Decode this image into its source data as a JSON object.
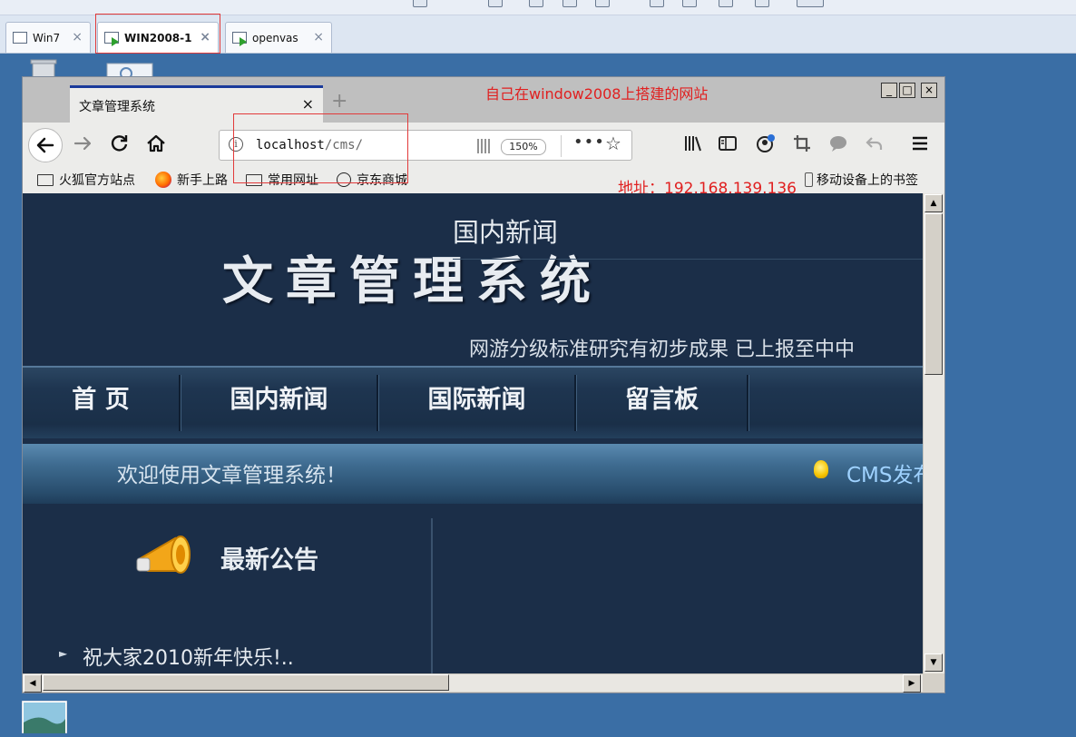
{
  "vm": {
    "tabs": [
      {
        "label": "Win7"
      },
      {
        "label": "WIN2008-1"
      },
      {
        "label": "openvas"
      }
    ],
    "close_glyph": "×"
  },
  "browser": {
    "tab_title": "文章管理系统",
    "tab_close": "×",
    "new_tab": "+",
    "annotation_title": "自己在window2008上搭建的网站",
    "window_controls": {
      "minimize": "_",
      "maximize": "□",
      "close": "×"
    },
    "url": {
      "host": "localhost",
      "path": "/cms/"
    },
    "zoom": "150%",
    "bookmarks": [
      "火狐官方站点",
      "新手上路",
      "常用网址",
      "京东商城"
    ],
    "annotation_address": "地址：192.168.139.136",
    "mobile_bookmarks": "移动设备上的书签",
    "toolbar_icons": [
      "library-icon",
      "sidebar-icon",
      "account-icon",
      "screenshot-icon",
      "chat-icon",
      "undo-icon",
      "menu-icon"
    ]
  },
  "site": {
    "title": "文章管理系统",
    "nav": [
      "首 页",
      "国内新闻",
      "国际新闻",
      "留言板"
    ],
    "welcome": "欢迎使用文章管理系统！",
    "ticker": "CMS发布",
    "notice_title": "最新公告",
    "notice_items": [
      "祝大家2010新年快乐!.."
    ],
    "news_title": "国内新闻",
    "news_items": [
      "网游分级标准研究有初步成果 已上报至中中"
    ]
  }
}
